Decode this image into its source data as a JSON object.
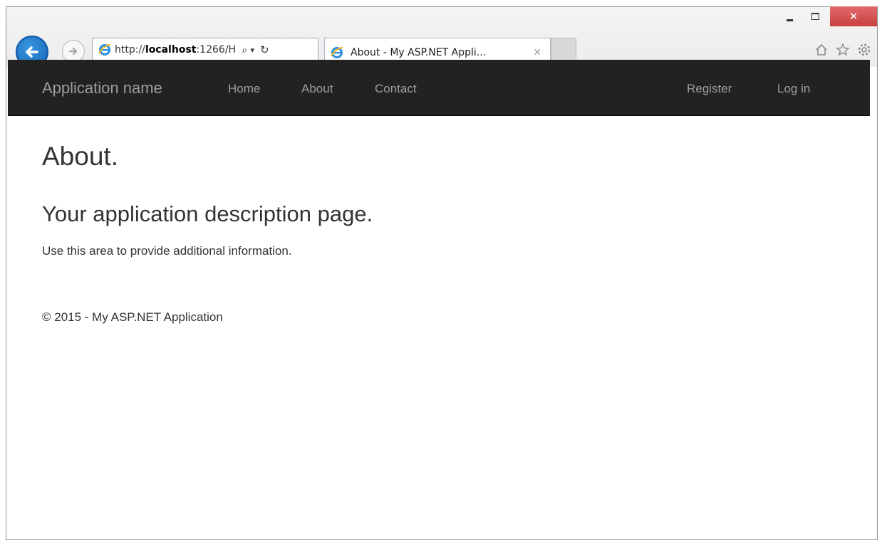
{
  "browser": {
    "address_url_prefix": "http://",
    "address_url_host": "localhost",
    "address_url_rest": ":1266/H",
    "search_glyph": "⌕",
    "refresh_glyph": "↻",
    "tab_title": "About - My ASP.NET Appli...",
    "tab_close_glyph": "✕",
    "close_glyph": "✕",
    "icons": [
      "home-icon",
      "favorites-star-icon",
      "settings-gear-icon"
    ]
  },
  "navbar": {
    "brand": "Application name",
    "links": [
      "Home",
      "About",
      "Contact"
    ],
    "right_links": [
      "Register",
      "Log in"
    ]
  },
  "page": {
    "title": "About.",
    "subtitle": "Your application description page.",
    "description": "Use this area to provide additional information.",
    "footer": "© 2015 - My ASP.NET Application"
  },
  "colors": {
    "navbar_bg": "#222222",
    "navbar_text": "#9d9d9d",
    "back_button": "#1a73c8",
    "close_button": "#c9403f"
  }
}
